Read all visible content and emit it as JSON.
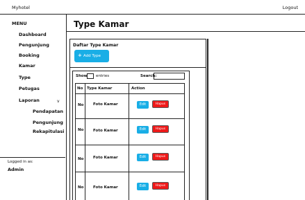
{
  "app": {
    "title": "Myhotel",
    "logout_label": "Logout"
  },
  "sidebar": {
    "menu_heading": "MENU",
    "items": [
      {
        "label": "Dashboard"
      },
      {
        "label": "Pengunjung"
      },
      {
        "label": "Booking"
      },
      {
        "label": "Kamar"
      },
      {
        "label": "Type"
      },
      {
        "label": "Petugas"
      },
      {
        "label": "Laporan"
      },
      {
        "label": "Pendapatan"
      },
      {
        "label": "Pengunjung"
      },
      {
        "label": "Rekapitulasi"
      }
    ],
    "laporan_chevron": "v",
    "logged_in_label": "Logged in as:",
    "logged_in_user": "Admin"
  },
  "main": {
    "page_title": "Type Kamar",
    "card_title": "Daftar Type Kamar",
    "add_button_label": "Add Type",
    "add_button_icon": "+",
    "table_controls": {
      "show_label": "Show",
      "entries_label": "entries",
      "search_label": "Search:"
    },
    "columns": [
      "No",
      "Type Kamar",
      "Action"
    ],
    "rows": [
      {
        "no": "No",
        "photo": "Foto Kamar",
        "edit": "Edit",
        "delete": "Hapus"
      },
      {
        "no": "No",
        "photo": "Foto Kamar",
        "edit": "Edit",
        "delete": "Hapus"
      },
      {
        "no": "No",
        "photo": "Foto Kamar",
        "edit": "Edit",
        "delete": "Hapus"
      },
      {
        "no": "No",
        "photo": "Foto Kamar",
        "edit": "Edit",
        "delete": "Hapus"
      }
    ]
  },
  "colors": {
    "primary": "#19aee6",
    "danger": "#ee1a1a"
  }
}
